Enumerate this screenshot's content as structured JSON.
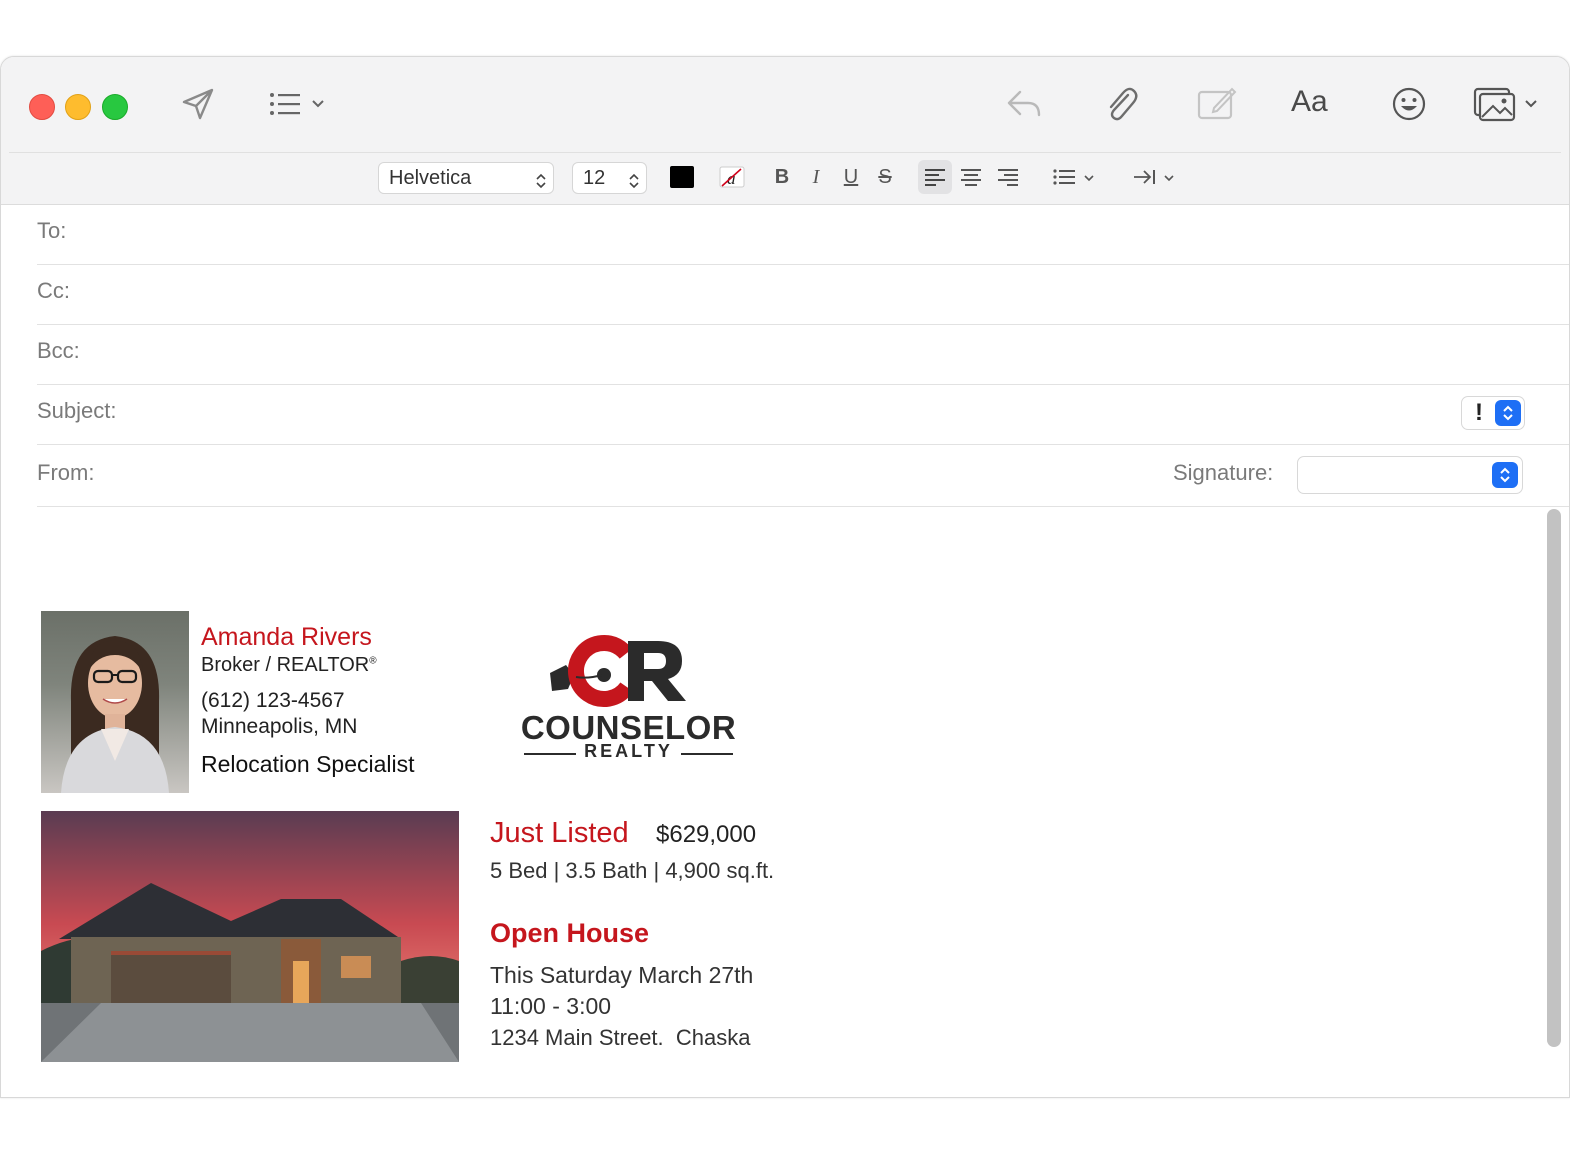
{
  "format_bar": {
    "font_name": "Helvetica",
    "font_size": "12",
    "bold_label": "B",
    "italic_label": "I",
    "underline_label": "U",
    "strike_label": "S",
    "text_color": "#000000"
  },
  "toolbar": {
    "font_panel_label": "Aa"
  },
  "fields": {
    "to_label": "To:",
    "cc_label": "Cc:",
    "bcc_label": "Bcc:",
    "subject_label": "Subject:",
    "priority_symbol": "!",
    "from_label": "From:",
    "signature_label": "Signature:"
  },
  "signature": {
    "name": "Amanda Rivers",
    "title": "Broker / REALTOR",
    "title_mark": "®",
    "phone": "(612) 123-4567",
    "city": "Minneapolis, MN",
    "specialty": "Relocation Specialist",
    "logo_letters": "CR",
    "logo_word": "COUNSELOR",
    "logo_sub": "REALTY"
  },
  "listing": {
    "headline": "Just Listed",
    "price": "$629,000",
    "specs": "5 Bed | 3.5 Bath | 4,900 sq.ft.",
    "open_house_heading": "Open House",
    "date": "This Saturday March 27th",
    "time": "11:00 - 3:00",
    "address": "1234 Main Street.  Chaska"
  },
  "colors": {
    "brand_red": "#c5161d",
    "accent_blue": "#1e6ff5"
  }
}
